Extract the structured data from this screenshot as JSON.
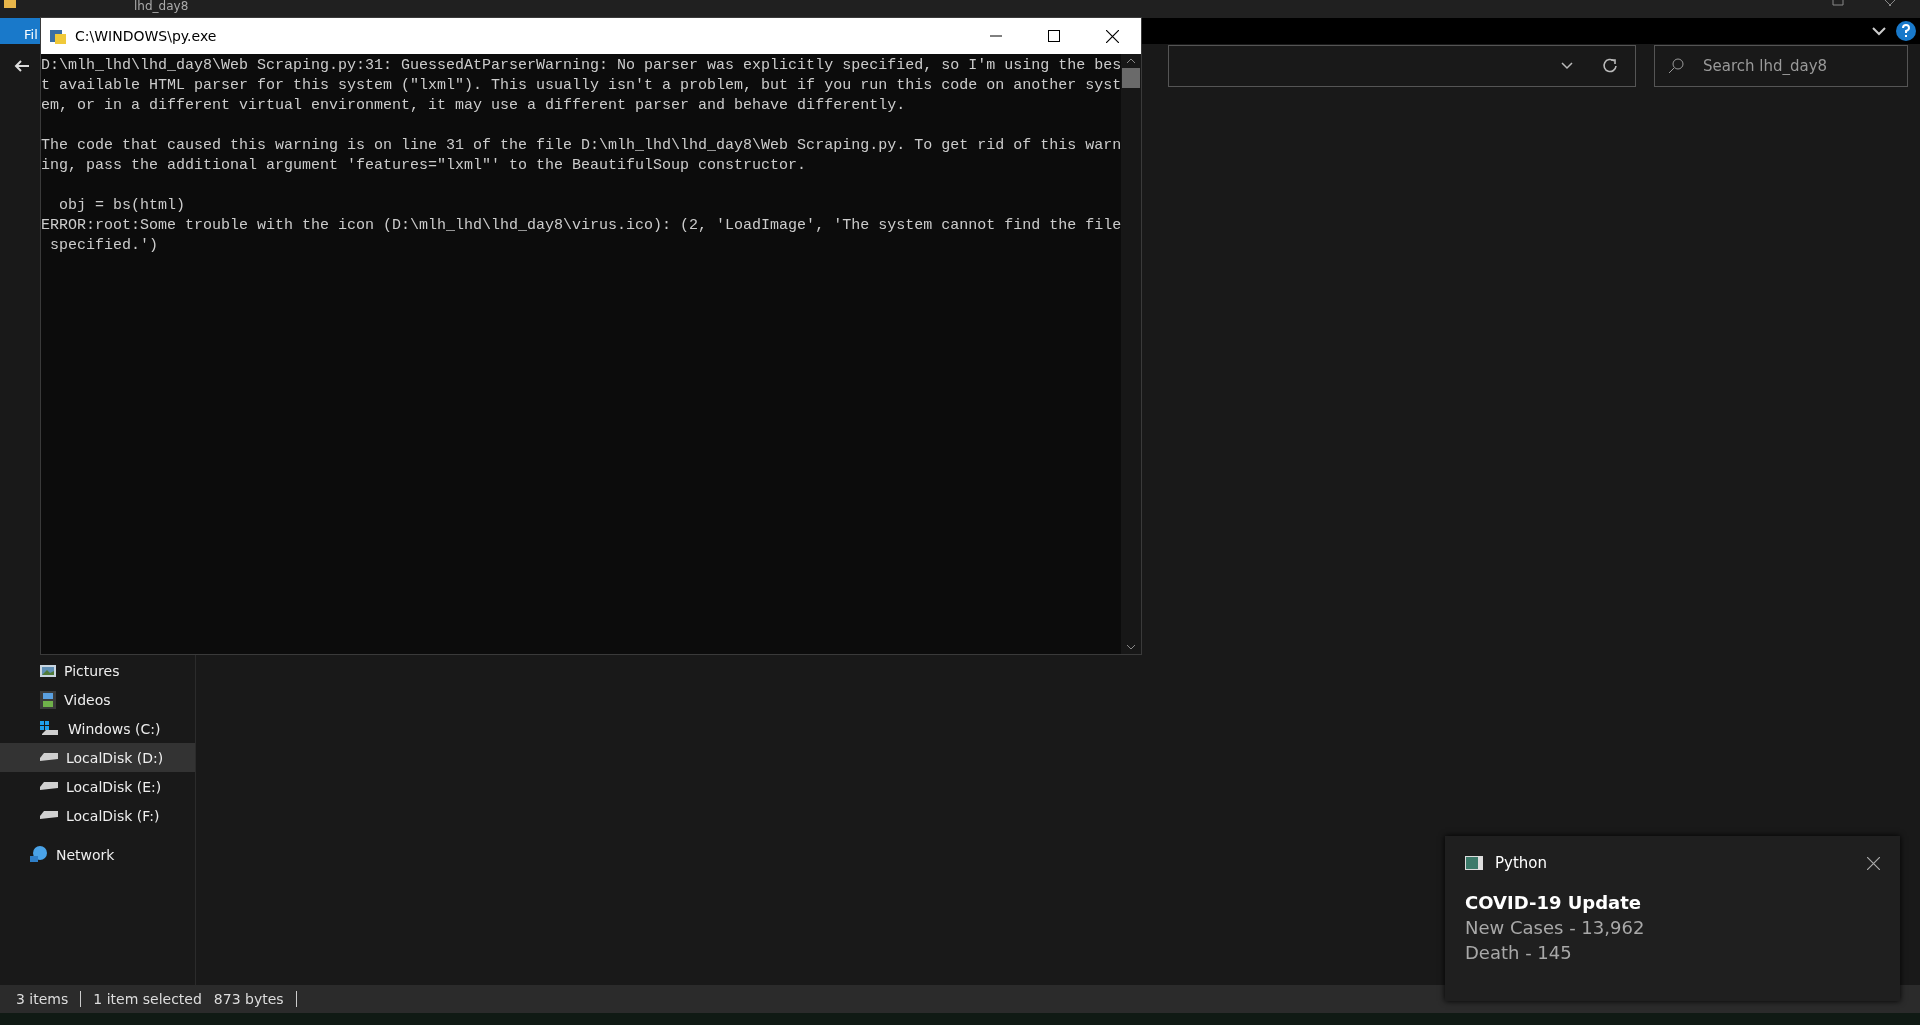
{
  "explorer": {
    "title": "lhd_day8",
    "ribbon_tab": "Fil",
    "search": {
      "placeholder": "Search lhd_day8"
    },
    "sidebar": {
      "items": [
        {
          "label": "Pictures",
          "kind": "pictures",
          "selected": false
        },
        {
          "label": "Videos",
          "kind": "videos",
          "selected": false
        },
        {
          "label": "Windows (C:)",
          "kind": "system-drive",
          "selected": false
        },
        {
          "label": "LocalDisk (D:)",
          "kind": "drive",
          "selected": true
        },
        {
          "label": "LocalDisk (E:)",
          "kind": "drive",
          "selected": false
        },
        {
          "label": "LocalDisk (F:)",
          "kind": "drive",
          "selected": false
        },
        {
          "label": "Network",
          "kind": "network",
          "selected": false
        }
      ]
    },
    "status_bar": [
      "3 items",
      "1 item selected",
      "873 bytes"
    ]
  },
  "console": {
    "title": "C:\\WINDOWS\\py.exe",
    "blocks": [
      [
        "D:\\mlh_lhd\\lhd_day8\\Web Scraping.py:31: GuessedAtParserWarning: No parser was explicitly specified, so I'm using the bes",
        "t available HTML parser for this system (\"lxml\"). This usually isn't a problem, but if you run this code on another syst",
        "em, or in a different virtual environment, it may use a different parser and behave differently."
      ],
      [
        "The code that caused this warning is on line 31 of the file D:\\mlh_lhd\\lhd_day8\\Web Scraping.py. To get rid of this warn",
        "ing, pass the additional argument 'features=\"lxml\"' to the BeautifulSoup constructor."
      ],
      [
        "  obj = bs(html)",
        "ERROR:root:Some trouble with the icon (D:\\mlh_lhd\\lhd_day8\\virus.ico): (2, 'LoadImage', 'The system cannot find the file",
        " specified.')"
      ]
    ]
  },
  "notification": {
    "app": "Python",
    "title": "COVID-19 Update",
    "lines": [
      "New Cases - 13,962",
      "Death - 145"
    ]
  }
}
